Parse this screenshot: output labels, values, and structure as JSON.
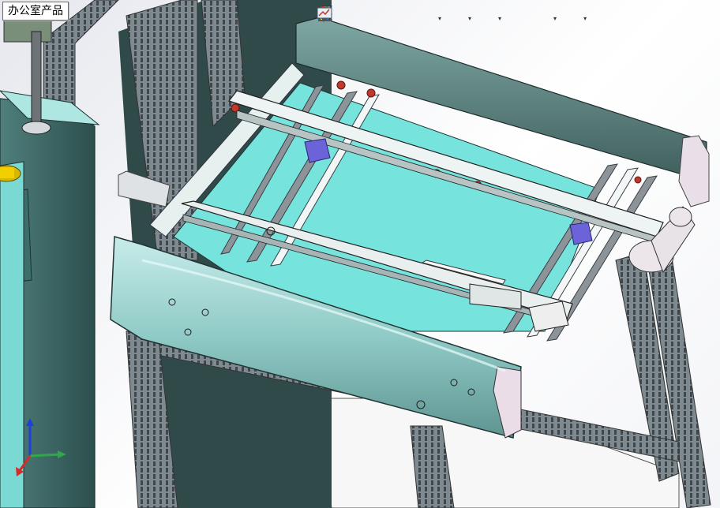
{
  "window": {
    "tab_label": "办公室产品"
  },
  "toolbar": {
    "buttons": [
      {
        "id": "zoom-to-fit",
        "icon": "zoom-to-fit-icon"
      },
      {
        "id": "zoom-to-area",
        "icon": "zoom-to-area-icon"
      },
      {
        "id": "previous-view",
        "icon": "previous-view-icon"
      },
      {
        "id": "section-view",
        "icon": "section-view-icon"
      },
      {
        "id": "view-orientation",
        "icon": "view-orientation-icon",
        "dropdown": true
      },
      {
        "id": "display-style",
        "icon": "display-style-icon",
        "dropdown": true
      },
      {
        "id": "hide-show-items",
        "icon": "hide-show-icon",
        "dropdown": true
      },
      {
        "id": "edit-appearance",
        "icon": "appearance-icon"
      },
      {
        "id": "apply-scene",
        "icon": "scene-icon",
        "dropdown": true
      },
      {
        "id": "view-settings",
        "icon": "view-settings-icon",
        "dropdown": true
      }
    ]
  },
  "model": {
    "description_visible": false,
    "display_mode": "shaded-with-edges"
  },
  "triad": {
    "axes": [
      "x",
      "y",
      "z"
    ]
  },
  "colors": {
    "frame": "#5f6a70",
    "panel_teal": "#7fe6e0",
    "cover": "#9ed3cf",
    "rail": "#e6f0ef",
    "accent_red": "#c0392b",
    "accent_purple": "#6a5acd",
    "background": "#ffffff"
  }
}
